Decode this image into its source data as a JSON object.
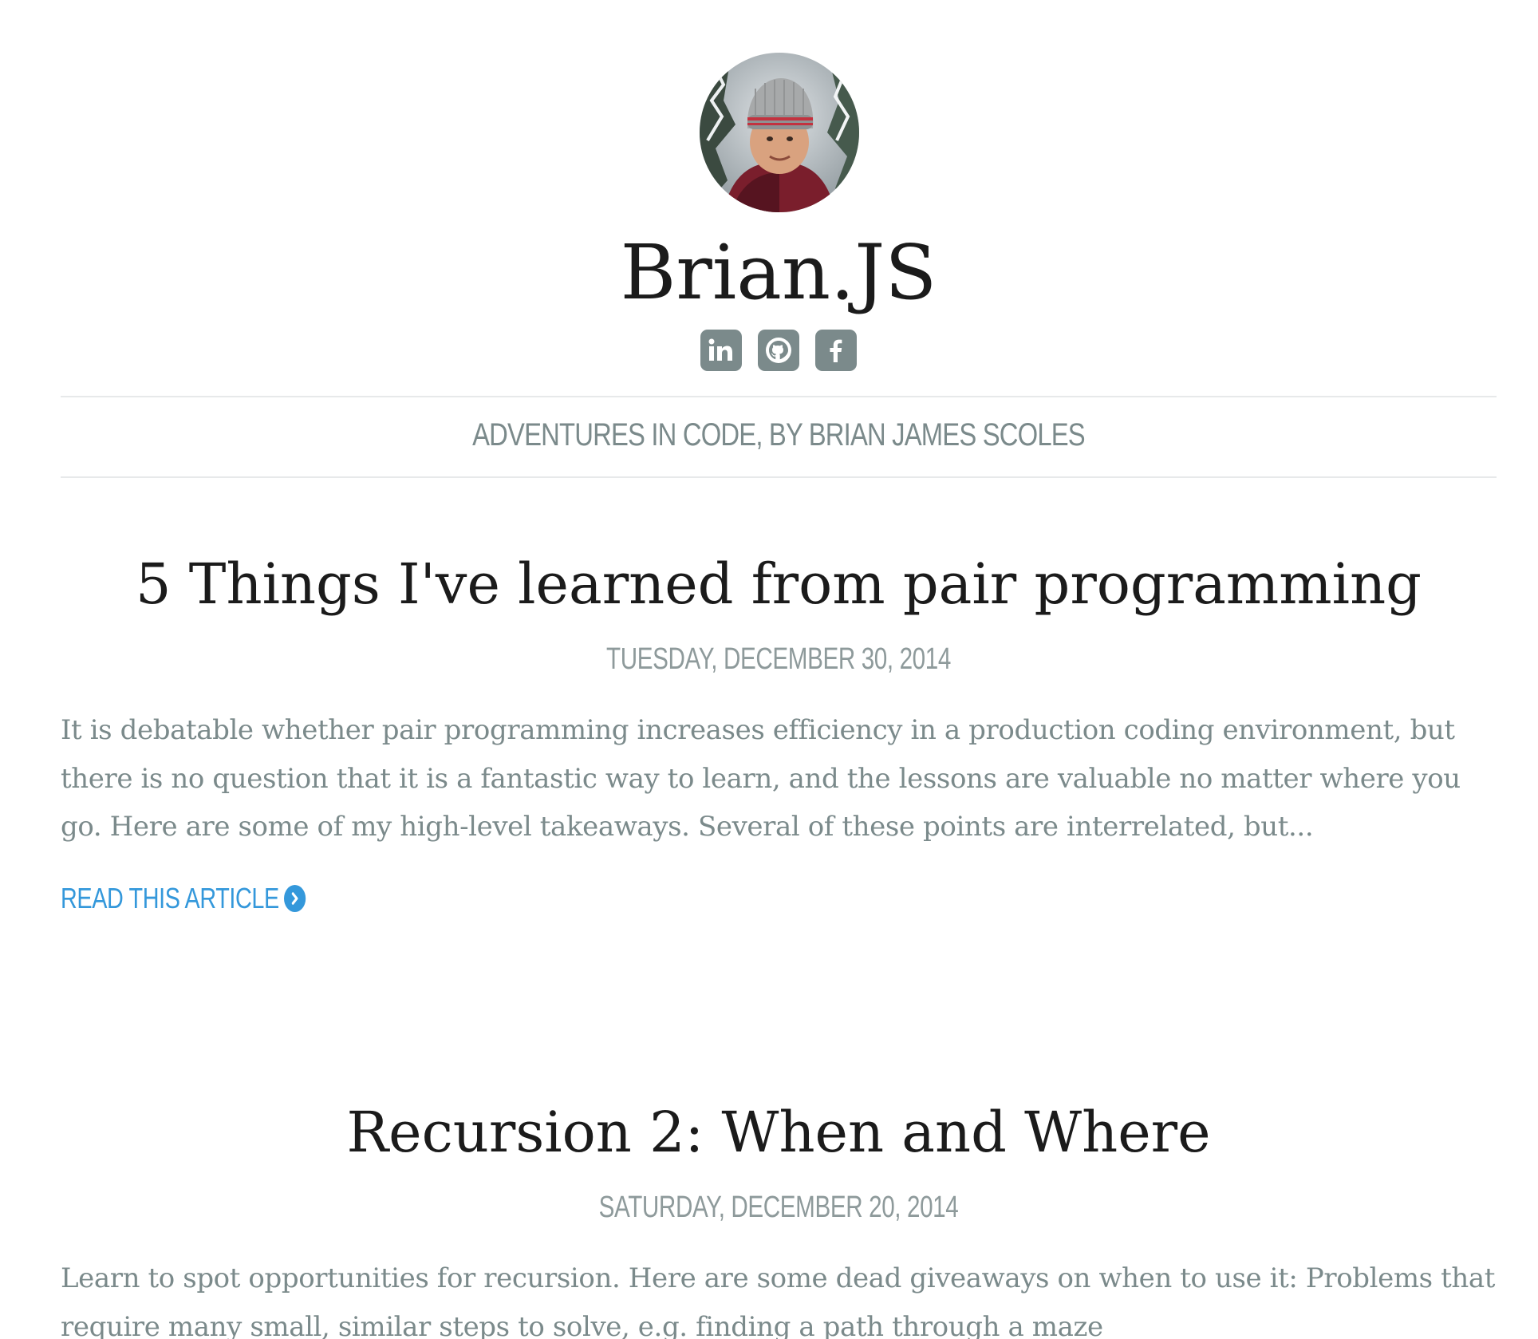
{
  "site": {
    "title": "Brian.JS",
    "tagline": "ADVENTURES IN CODE, BY BRIAN JAMES SCOLES",
    "avatar_alt": "Profile photo",
    "socials": [
      {
        "name": "linkedin-icon",
        "label": "in"
      },
      {
        "name": "github-icon",
        "label": "GitHub"
      },
      {
        "name": "facebook-icon",
        "label": "f"
      }
    ]
  },
  "posts": [
    {
      "title": "5 Things I've learned from pair programming",
      "date": "TUESDAY, DECEMBER 30, 2014",
      "excerpt": "It is debatable whether pair programming increases efficiency in a production coding environment, but there is no question that it is a fantastic way to learn, and the lessons are valuable no matter where you go. Here are some of my high-level takeaways. Several of these points are interrelated, but...",
      "read_more": "READ THIS ARTICLE"
    },
    {
      "title": "Recursion 2: When and Where",
      "date": "SATURDAY, DECEMBER 20, 2014",
      "excerpt": "Learn to spot opportunities for recursion. Here are some dead giveaways on when to use it: Problems that require many small, similar steps to solve, e.g. finding a path through a maze"
    }
  ],
  "colors": {
    "accent": "#3498db",
    "muted": "#7b8a8b",
    "heading": "#1b1b1b",
    "social_bg": "#7b8a8b",
    "rule": "#e7e9ea"
  }
}
